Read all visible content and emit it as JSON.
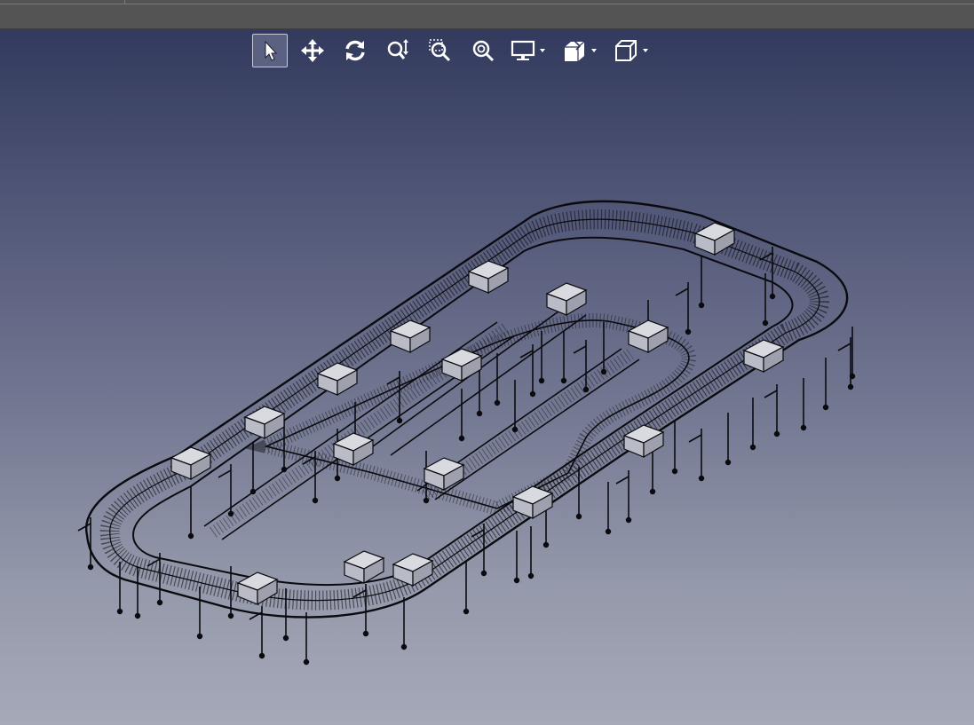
{
  "window": {
    "title": ""
  },
  "toolbar": {
    "tools": [
      {
        "id": "select",
        "icon": "select-arrow-icon",
        "active": true
      },
      {
        "id": "pan",
        "icon": "pan-arrows-icon",
        "active": false
      },
      {
        "id": "rotate",
        "icon": "rotate-icon",
        "active": false
      },
      {
        "id": "zoom",
        "icon": "zoom-updown-icon",
        "active": false
      },
      {
        "id": "zoom-window",
        "icon": "zoom-window-icon",
        "active": false
      },
      {
        "id": "zoom-fit",
        "icon": "zoom-fit-icon",
        "active": false
      },
      {
        "id": "display-mode",
        "icon": "monitor-icon",
        "dropdown": true
      },
      {
        "id": "section-view",
        "icon": "section-cube-icon",
        "dropdown": true
      },
      {
        "id": "view-cube",
        "icon": "cube-view-icon",
        "dropdown": true
      }
    ]
  },
  "viewport": {
    "background_top": "#323a5d",
    "background_bottom": "#a6a9b8",
    "model": "conveyor-loop-wireframe"
  },
  "colors": {
    "titlebar": "#545454",
    "icon": "#ffffff",
    "active_tool_bg": "#5b6180",
    "wire": "#0b0b0f",
    "box_face": "#d8dae0"
  }
}
